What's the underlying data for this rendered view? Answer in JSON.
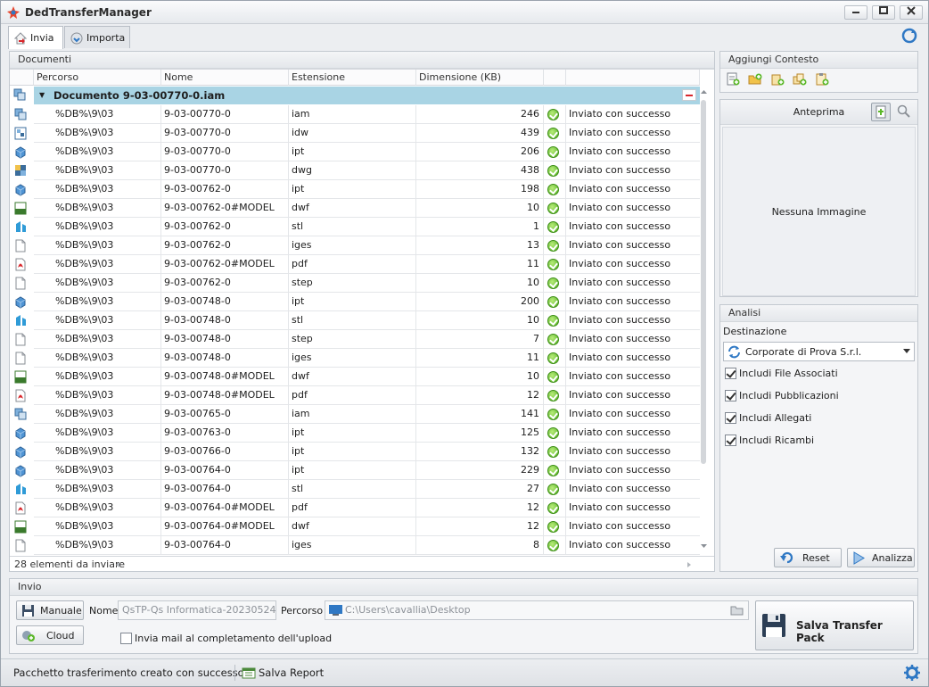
{
  "window": {
    "title": "DedTransferManager"
  },
  "tabs": [
    {
      "label": "Invia"
    },
    {
      "label": "Importa"
    }
  ],
  "documents": {
    "panel_title": "Documenti",
    "columns": {
      "path": "Percorso",
      "name": "Nome",
      "extension": "Estensione",
      "size": "Dimensione (KB)"
    },
    "group_label": "Documento 9-03-00770-0.iam",
    "rows": [
      {
        "icon": "assembly-icon",
        "path": "%DB%\\9\\03",
        "name": "9-03-00770-0",
        "ext": "iam",
        "size": "246",
        "status": "Inviato con successo"
      },
      {
        "icon": "drawing-icon",
        "path": "%DB%\\9\\03",
        "name": "9-03-00770-0",
        "ext": "idw",
        "size": "439",
        "status": "Inviato con successo"
      },
      {
        "icon": "part-icon",
        "path": "%DB%\\9\\03",
        "name": "9-03-00770-0",
        "ext": "ipt",
        "size": "206",
        "status": "Inviato con successo"
      },
      {
        "icon": "dwg-icon",
        "path": "%DB%\\9\\03",
        "name": "9-03-00770-0",
        "ext": "dwg",
        "size": "438",
        "status": "Inviato con successo"
      },
      {
        "icon": "part-icon",
        "path": "%DB%\\9\\03",
        "name": "9-03-00762-0",
        "ext": "ipt",
        "size": "198",
        "status": "Inviato con successo"
      },
      {
        "icon": "dwf-icon",
        "path": "%DB%\\9\\03",
        "name": "9-03-00762-0#MODEL",
        "ext": "dwf",
        "size": "10",
        "status": "Inviato con successo"
      },
      {
        "icon": "stl-icon",
        "path": "%DB%\\9\\03",
        "name": "9-03-00762-0",
        "ext": "stl",
        "size": "1",
        "status": "Inviato con successo"
      },
      {
        "icon": "file-icon",
        "path": "%DB%\\9\\03",
        "name": "9-03-00762-0",
        "ext": "iges",
        "size": "13",
        "status": "Inviato con successo"
      },
      {
        "icon": "pdf-icon",
        "path": "%DB%\\9\\03",
        "name": "9-03-00762-0#MODEL",
        "ext": "pdf",
        "size": "11",
        "status": "Inviato con successo"
      },
      {
        "icon": "file-icon",
        "path": "%DB%\\9\\03",
        "name": "9-03-00762-0",
        "ext": "step",
        "size": "10",
        "status": "Inviato con successo"
      },
      {
        "icon": "part-icon",
        "path": "%DB%\\9\\03",
        "name": "9-03-00748-0",
        "ext": "ipt",
        "size": "200",
        "status": "Inviato con successo"
      },
      {
        "icon": "stl-icon",
        "path": "%DB%\\9\\03",
        "name": "9-03-00748-0",
        "ext": "stl",
        "size": "10",
        "status": "Inviato con successo"
      },
      {
        "icon": "file-icon",
        "path": "%DB%\\9\\03",
        "name": "9-03-00748-0",
        "ext": "step",
        "size": "7",
        "status": "Inviato con successo"
      },
      {
        "icon": "file-icon",
        "path": "%DB%\\9\\03",
        "name": "9-03-00748-0",
        "ext": "iges",
        "size": "11",
        "status": "Inviato con successo"
      },
      {
        "icon": "dwf-icon",
        "path": "%DB%\\9\\03",
        "name": "9-03-00748-0#MODEL",
        "ext": "dwf",
        "size": "10",
        "status": "Inviato con successo"
      },
      {
        "icon": "pdf-icon",
        "path": "%DB%\\9\\03",
        "name": "9-03-00748-0#MODEL",
        "ext": "pdf",
        "size": "12",
        "status": "Inviato con successo"
      },
      {
        "icon": "assembly-icon",
        "path": "%DB%\\9\\03",
        "name": "9-03-00765-0",
        "ext": "iam",
        "size": "141",
        "status": "Inviato con successo"
      },
      {
        "icon": "part-icon",
        "path": "%DB%\\9\\03",
        "name": "9-03-00763-0",
        "ext": "ipt",
        "size": "125",
        "status": "Inviato con successo"
      },
      {
        "icon": "part-icon",
        "path": "%DB%\\9\\03",
        "name": "9-03-00766-0",
        "ext": "ipt",
        "size": "132",
        "status": "Inviato con successo"
      },
      {
        "icon": "part-icon",
        "path": "%DB%\\9\\03",
        "name": "9-03-00764-0",
        "ext": "ipt",
        "size": "229",
        "status": "Inviato con successo"
      },
      {
        "icon": "stl-icon",
        "path": "%DB%\\9\\03",
        "name": "9-03-00764-0",
        "ext": "stl",
        "size": "27",
        "status": "Inviato con successo"
      },
      {
        "icon": "pdf-icon",
        "path": "%DB%\\9\\03",
        "name": "9-03-00764-0#MODEL",
        "ext": "pdf",
        "size": "12",
        "status": "Inviato con successo"
      },
      {
        "icon": "dwf-icon",
        "path": "%DB%\\9\\03",
        "name": "9-03-00764-0#MODEL",
        "ext": "dwf",
        "size": "12",
        "status": "Inviato con successo"
      },
      {
        "icon": "file-icon",
        "path": "%DB%\\9\\03",
        "name": "9-03-00764-0",
        "ext": "iges",
        "size": "8",
        "status": "Inviato con successo"
      }
    ],
    "footer": "28 elementi da inviare"
  },
  "context": {
    "panel_title": "Aggiungi Contesto"
  },
  "preview": {
    "panel_title": "Anteprima",
    "empty_text": "Nessuna Immagine"
  },
  "analysis": {
    "panel_title": "Analisi",
    "destination_label": "Destinazione",
    "destination_value": "Corporate di Prova S.r.l.",
    "options": [
      {
        "label": "Includi File Associati",
        "checked": true
      },
      {
        "label": "Includi Pubblicazioni",
        "checked": true
      },
      {
        "label": "Includi Allegati",
        "checked": true
      },
      {
        "label": "Includi Ricambi",
        "checked": true
      }
    ],
    "reset_label": "Reset",
    "analyze_label": "Analizza"
  },
  "send": {
    "panel_title": "Invio",
    "manual_label": "Manuale",
    "cloud_label": "Cloud",
    "name_label": "Nome",
    "name_value": "QsTP-Qs Informatica-202305241...",
    "path_label": "Percorso",
    "path_value": "C:\\Users\\cavallia\\Desktop",
    "mail_label": "Invia mail al completamento dell'upload",
    "save_label": "Salva Transfer Pack"
  },
  "status": {
    "message": "Pacchetto trasferimento creato con successo",
    "report_label": "Salva Report"
  },
  "colors": {
    "group_row": "#a9d4e4",
    "ok_green": "#4fae1e",
    "accent_blue": "#2f78c4"
  }
}
